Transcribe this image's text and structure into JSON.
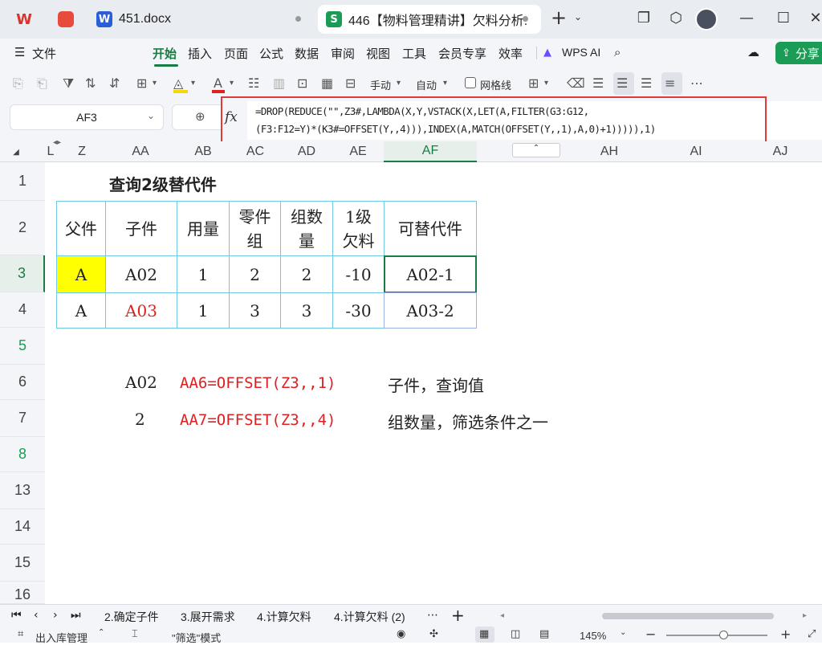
{
  "titlebar": {
    "tabs": [
      {
        "label": "451.docx",
        "icon": "W",
        "icon_color": "#2b5fd9"
      },
      {
        "label": "446【物料管理精讲】欠料分析:",
        "icon": "S",
        "icon_color": "#1a9c56"
      }
    ],
    "new_tab": "+"
  },
  "menu": {
    "file": "文件",
    "items": [
      "开始",
      "插入",
      "页面",
      "公式",
      "数据",
      "审阅",
      "视图",
      "工具",
      "会员专享",
      "效率"
    ],
    "ai": "WPS AI",
    "share": "分享"
  },
  "toolbar": {
    "manual": "手动",
    "auto": "自动",
    "gridlines": "网格线"
  },
  "formula_bar": {
    "name_box": "AF3",
    "fx": "fx",
    "formula_line1": "=DROP(REDUCE(\"\",Z3#,LAMBDA(X,Y,VSTACK(X,LET(A,FILTER(G3:G12,",
    "formula_line2": "(F3:F12=Y)*(K3#=OFFSET(Y,,4))),INDEX(A,MATCH(OFFSET(Y,,1),A,0)+1))))),1)"
  },
  "columns": [
    "L",
    "Z",
    "AA",
    "AB",
    "AC",
    "AD",
    "AE",
    "AF",
    "AH",
    "AI",
    "AJ"
  ],
  "rows": [
    "1",
    "2",
    "3",
    "4",
    "5",
    "6",
    "7",
    "8",
    "13",
    "14",
    "15",
    "16"
  ],
  "sheet": {
    "title": "查询2级替代件",
    "headers": [
      "父件",
      "子件",
      "用量",
      "零件组",
      "组数量",
      "1级欠料",
      "可替代件"
    ],
    "rows": [
      [
        "A",
        "A02",
        "1",
        "2",
        "2",
        "-10",
        "A02-1"
      ],
      [
        "A",
        "A03",
        "1",
        "3",
        "3",
        "-30",
        "A03-2"
      ]
    ],
    "note1_value": "A02",
    "note1_formula": "AA6=OFFSET(Z3,,1)",
    "note1_desc": "子件，查询值",
    "note2_value": "2",
    "note2_formula": "AA7=OFFSET(Z3,,4)",
    "note2_desc": "组数量，筛选条件之一"
  },
  "sheet_tabs": [
    "2.确定子件",
    "3.展开需求",
    "4.计算欠料",
    "4.计算欠料 (2)"
  ],
  "status": {
    "left": "出入库管理",
    "mode": "\"筛选\"模式",
    "zoom": "145%"
  },
  "colors": {
    "accent": "#1a7c44",
    "highlight_yellow": "#ffff00",
    "red": "#e02020",
    "border_blue": "#6fc8e6"
  }
}
